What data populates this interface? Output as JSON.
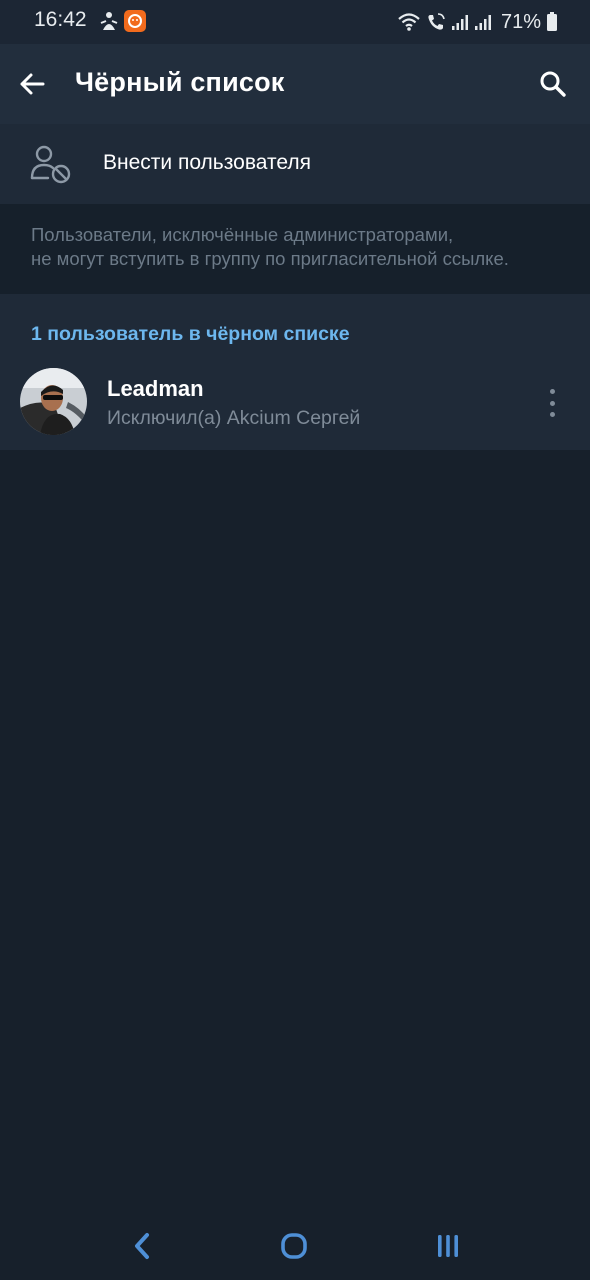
{
  "status_bar": {
    "time": "16:42",
    "battery_percent": "71%",
    "icons": [
      "notification-icon",
      "app-notification-icon",
      "wifi-icon",
      "wifi-call-icon",
      "signal-icon",
      "signal-icon",
      "battery-icon"
    ],
    "accent_notification_color": "#f26b1d"
  },
  "app_bar": {
    "title": "Чёрный список",
    "back_icon": "arrow-left-icon",
    "search_icon": "search-icon"
  },
  "add_user": {
    "label": "Внести пользователя",
    "icon": "user-block-icon"
  },
  "info": {
    "line1": "Пользователи, исключённые администраторами,",
    "line2": "не могут вступить в группу по пригласительной ссылке."
  },
  "blocked_list": {
    "header": "1 пользователь в чёрном списке",
    "items": [
      {
        "name": "Leadman",
        "subtitle": "Исключил(а) Akcium Сергей",
        "menu_icon": "more-vertical-icon"
      }
    ]
  },
  "nav_bar": {
    "buttons": [
      "back-nav-icon",
      "home-nav-icon",
      "recents-nav-icon"
    ]
  },
  "colors": {
    "background": "#17202b",
    "header_bg": "#222e3d",
    "section_bg": "#1f2a38",
    "accent": "#6db7ee",
    "muted_text": "#7f8b98"
  }
}
